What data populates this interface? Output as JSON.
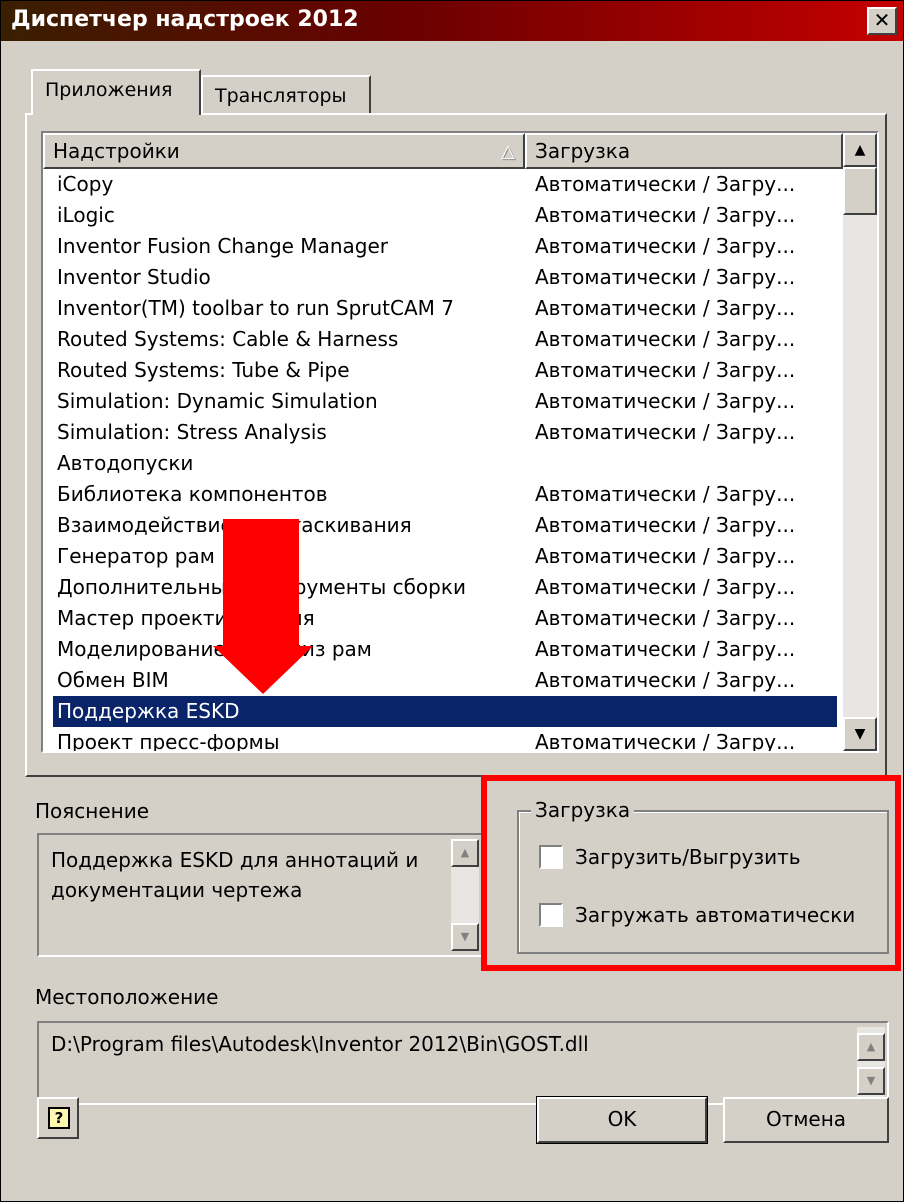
{
  "window": {
    "title": "Диспетчер надстроек 2012",
    "close_glyph": "✕"
  },
  "tabs": [
    {
      "label": "Приложения",
      "active": true
    },
    {
      "label": "Трансляторы",
      "active": false
    }
  ],
  "list": {
    "columns": {
      "name": "Надстройки",
      "load": "Загрузка"
    },
    "rows": [
      {
        "name": "iCopy",
        "load": "Автоматически / Загру..."
      },
      {
        "name": "iLogic",
        "load": "Автоматически / Загру..."
      },
      {
        "name": "Inventor Fusion Change Manager",
        "load": "Автоматически / Загру..."
      },
      {
        "name": "Inventor Studio",
        "load": "Автоматически / Загру..."
      },
      {
        "name": "Inventor(TM) toolbar to run SprutCAM 7",
        "load": "Автоматически / Загру..."
      },
      {
        "name": "Routed Systems: Cable & Harness",
        "load": "Автоматически / Загру..."
      },
      {
        "name": "Routed Systems: Tube & Pipe",
        "load": "Автоматически / Загру..."
      },
      {
        "name": "Simulation: Dynamic Simulation",
        "load": "Автоматически / Загру..."
      },
      {
        "name": "Simulation: Stress Analysis",
        "load": "Автоматически / Загру..."
      },
      {
        "name": "Автодопуски",
        "load": ""
      },
      {
        "name": "Библиотека компонентов",
        "load": "Автоматически / Загру..."
      },
      {
        "name": "Взаимодействие перетаскивания",
        "load": "Автоматически / Загру..."
      },
      {
        "name": "Генератор рам",
        "load": "Автоматически / Загру..."
      },
      {
        "name": "Дополнительные инструменты сборки",
        "load": "Автоматически / Загру..."
      },
      {
        "name": "Мастер проектирования",
        "load": "Автоматически / Загру..."
      },
      {
        "name": "Моделирование и анализ рам",
        "load": "Автоматически / Загру..."
      },
      {
        "name": "Обмен BIM",
        "load": "Автоматически / Загру..."
      },
      {
        "name": "Поддержка ESKD",
        "load": "",
        "selected": true
      },
      {
        "name": "Проект пресс-формы",
        "load": "Автоматически / Загру..."
      }
    ]
  },
  "description": {
    "label": "Пояснение",
    "line1": "Поддержка ESKD для аннотаций и",
    "line2": "документации чертежа"
  },
  "load_group": {
    "legend": "Загрузка",
    "load_unload": {
      "label": "Загрузить/Выгрузить",
      "checked": false
    },
    "autoload": {
      "label": "Загружать автоматически",
      "checked": false
    }
  },
  "location": {
    "label": "Местоположение",
    "value": "D:\\Program files\\Autodesk\\Inventor 2012\\Bin\\GOST.dll"
  },
  "buttons": {
    "ok": "OK",
    "cancel": "Отмена",
    "help_glyph": "?"
  },
  "colors": {
    "selection": "#0a246a",
    "annotation": "#ff0000",
    "dialog_bg": "#d4d0c8"
  }
}
